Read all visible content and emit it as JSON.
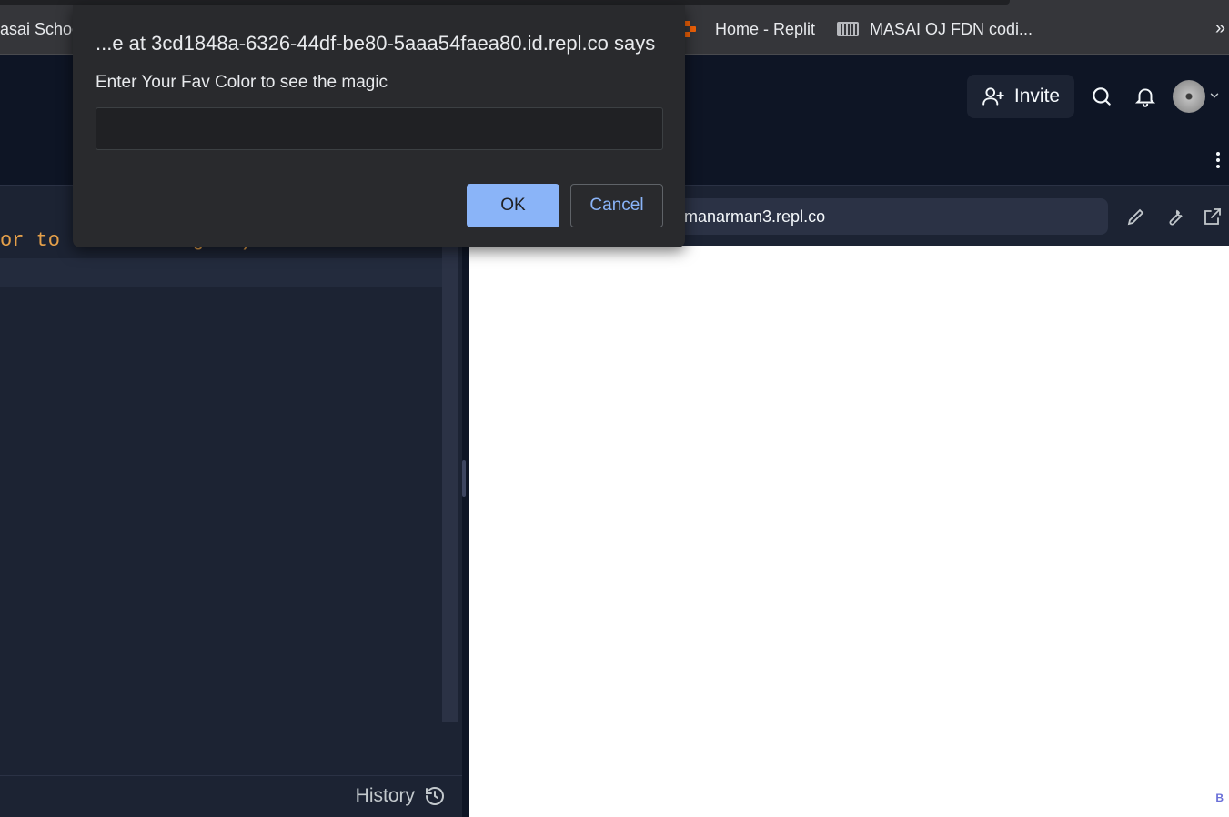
{
  "browser": {
    "bookmarks": [
      {
        "label": "asai Schoo",
        "icon": "none"
      },
      {
        "label": "Home - Replit",
        "icon": "replit-logo-icon"
      },
      {
        "label": "MASAI OJ FDN codi...",
        "icon": "keyboard-icon"
      }
    ],
    "more_label": "»"
  },
  "header": {
    "invite_label": "Invite"
  },
  "editor": {
    "code_line": "or to see the magic\")",
    "history_label": "History"
  },
  "webview": {
    "url": "manarman3.repl.co",
    "badge": "B"
  },
  "dialog": {
    "title": "...e at 3cd1848a-6326-44df-be80-5aaa54faea80.id.repl.co says",
    "message": "Enter Your Fav Color to see the magic",
    "input_value": "",
    "ok_label": "OK",
    "cancel_label": "Cancel"
  },
  "colors": {
    "accent": "#8ab4f8",
    "replit_orange": "#f26207",
    "code_string": "#e5a04a"
  }
}
